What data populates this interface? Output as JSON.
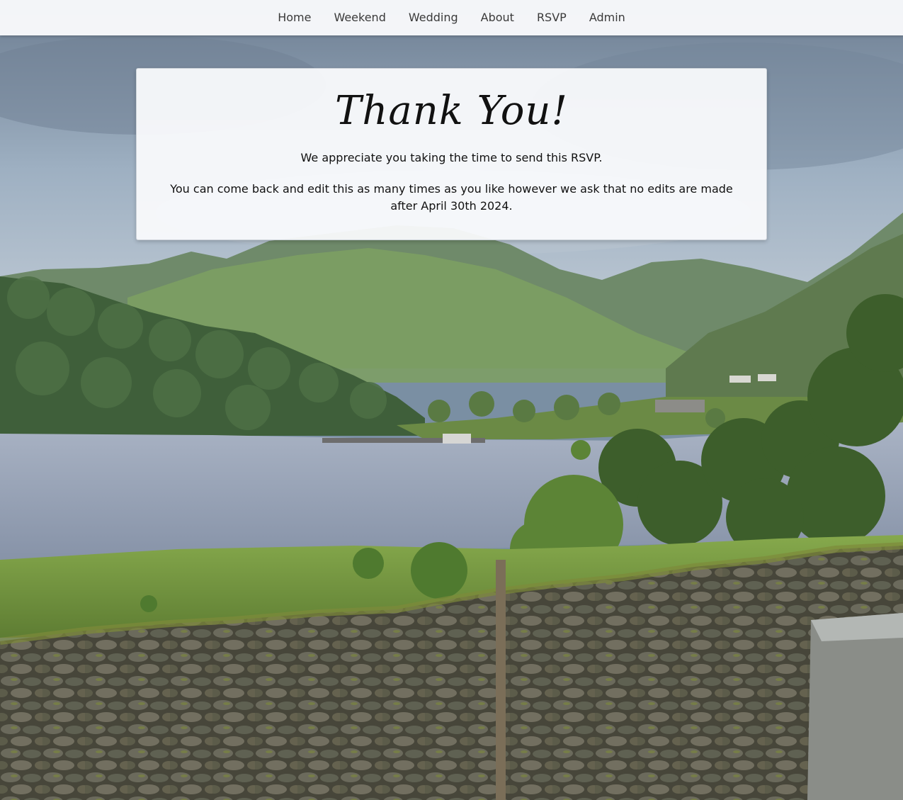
{
  "nav": {
    "items": [
      {
        "label": "Home"
      },
      {
        "label": "Weekend"
      },
      {
        "label": "Wedding"
      },
      {
        "label": "About"
      },
      {
        "label": "RSVP"
      },
      {
        "label": "Admin"
      }
    ]
  },
  "card": {
    "title": "Thank You!",
    "paragraph_1": "We appreciate you taking the time to send this RSVP.",
    "paragraph_2": "You can come back and edit this as many times as you like however we ask that no edits are made after April 30th 2024."
  },
  "background": {
    "icon": "landscape-photo",
    "colors": {
      "sky": "#8d9fb2",
      "mountain": "#6f8a6a",
      "lake": "#a4aec0",
      "field": "#7fa14a",
      "stone_wall": "#4a4a3c"
    }
  }
}
